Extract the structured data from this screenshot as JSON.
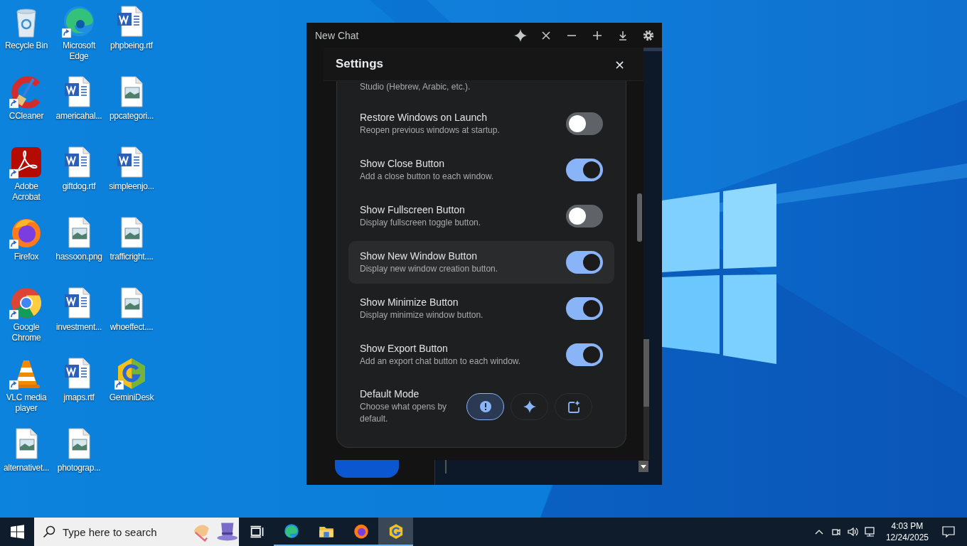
{
  "desktop": {
    "icons": [
      {
        "kind": "recycle-bin",
        "label": "Recycle Bin",
        "shortcut": false
      },
      {
        "kind": "edge",
        "label": "Microsoft Edge",
        "shortcut": true
      },
      {
        "kind": "word",
        "label": "phpbeing.rtf",
        "shortcut": false
      },
      {
        "kind": "ccleaner",
        "label": "CCleaner",
        "shortcut": true
      },
      {
        "kind": "word",
        "label": "americahal...",
        "shortcut": false
      },
      {
        "kind": "image",
        "label": "ppcategori...",
        "shortcut": false
      },
      {
        "kind": "acrobat",
        "label": "Adobe Acrobat",
        "shortcut": true
      },
      {
        "kind": "word",
        "label": "giftdog.rtf",
        "shortcut": false
      },
      {
        "kind": "word",
        "label": "simpleenjo...",
        "shortcut": false
      },
      {
        "kind": "firefox",
        "label": "Firefox",
        "shortcut": true
      },
      {
        "kind": "image",
        "label": "hassoon.png",
        "shortcut": false
      },
      {
        "kind": "image",
        "label": "trafficright....",
        "shortcut": false
      },
      {
        "kind": "chrome",
        "label": "Google Chrome",
        "shortcut": true
      },
      {
        "kind": "word",
        "label": "investment...",
        "shortcut": false
      },
      {
        "kind": "image",
        "label": "whoeffect....",
        "shortcut": false
      },
      {
        "kind": "vlc",
        "label": "VLC media player",
        "shortcut": true
      },
      {
        "kind": "word",
        "label": "jmaps.rtf",
        "shortcut": false
      },
      {
        "kind": "gemini",
        "label": "GeminiDesk",
        "shortcut": true
      },
      {
        "kind": "image",
        "label": "alternativet...",
        "shortcut": false
      },
      {
        "kind": "image",
        "label": "photograp...",
        "shortcut": false
      }
    ]
  },
  "app_window": {
    "title": "New Chat",
    "settings": {
      "title": "Settings",
      "close": "×",
      "partial_description": "Studio (Hebrew, Arabic, etc.).",
      "rows": [
        {
          "kind": "toggle",
          "title": "Restore Windows on Launch",
          "description": "Reopen previous windows at startup.",
          "on": false,
          "highlighted": false
        },
        {
          "kind": "toggle",
          "title": "Show Close Button",
          "description": "Add a close button to each window.",
          "on": true,
          "highlighted": false
        },
        {
          "kind": "toggle",
          "title": "Show Fullscreen Button",
          "description": "Display fullscreen toggle button.",
          "on": false,
          "highlighted": false
        },
        {
          "kind": "toggle",
          "title": "Show New Window Button",
          "description": "Display new window creation button.",
          "on": true,
          "highlighted": true
        },
        {
          "kind": "toggle",
          "title": "Show Minimize Button",
          "description": "Display minimize window button.",
          "on": true,
          "highlighted": false
        },
        {
          "kind": "toggle",
          "title": "Show Export Button",
          "description": "Add an export chat button to each window.",
          "on": true,
          "highlighted": false
        },
        {
          "kind": "mode",
          "title": "Default Mode",
          "description": "Choose what opens by default.",
          "options": [
            {
              "kind": "alert",
              "selected": true
            },
            {
              "kind": "sparkle",
              "selected": false
            },
            {
              "kind": "new-chat",
              "selected": false
            }
          ]
        }
      ]
    }
  },
  "taskbar": {
    "search": {
      "placeholder": "Type here to search"
    },
    "apps": [
      {
        "kind": "task-view",
        "running": false,
        "active": false
      },
      {
        "kind": "edge",
        "running": true,
        "active": false
      },
      {
        "kind": "explorer",
        "running": true,
        "active": false
      },
      {
        "kind": "firefox",
        "running": true,
        "active": false
      },
      {
        "kind": "gemini",
        "running": true,
        "active": true
      }
    ],
    "clock": {
      "time": "4:03 PM",
      "date": "12/24/2025"
    }
  }
}
